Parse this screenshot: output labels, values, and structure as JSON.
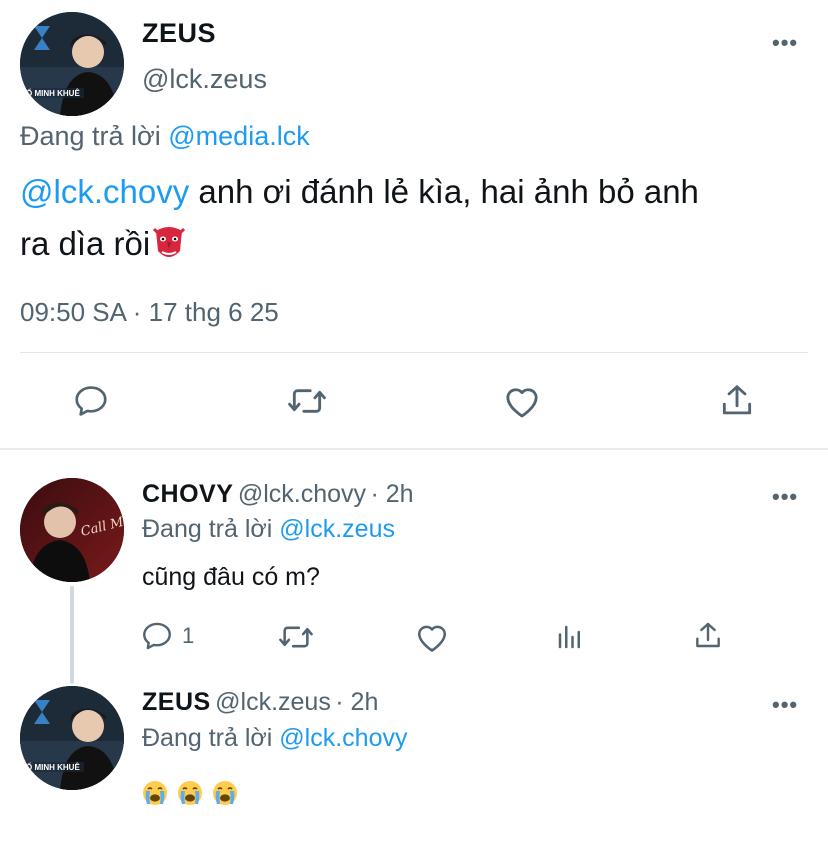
{
  "main_tweet": {
    "name": "ZEUS",
    "handle": "@lck.zeus",
    "replying_prefix": "Đang trả lời ",
    "replying_to": "@media.lck",
    "mention": "@lck.chovy",
    "text_line1": " anh ơi đánh lẻ kìa, hai ảnh bỏ anh",
    "text_line2": "ra dìa rồi",
    "emoji": "goblin-emoji",
    "timestamp": "09:50 SA · 17 thg 6 25",
    "avatar_caption": "Ố MINH KHUÊ"
  },
  "actions": {
    "reply_icon": "comment-icon",
    "retweet_icon": "retweet-icon",
    "like_icon": "heart-icon",
    "share_icon": "share-icon"
  },
  "replies": [
    {
      "name": "CHOVY",
      "handle": "@lck.chovy",
      "time": "· 2h",
      "replying_prefix": "Đang trả lời ",
      "replying_to": "@lck.zeus",
      "text": "cũng đâu có m?",
      "reply_count": "1",
      "avatar_text": "Call Me By Fire"
    },
    {
      "name": "ZEUS",
      "handle": "@lck.zeus",
      "time": "· 2h",
      "replying_prefix": "Đang trả lời ",
      "replying_to": "@lck.chovy",
      "emojis": [
        "crying-emoji",
        "crying-emoji",
        "crying-emoji"
      ],
      "avatar_caption": "Ố MINH KHUÊ"
    }
  ],
  "more_label": "•••",
  "colors": {
    "link": "#1d9bf0",
    "secondary": "#536471",
    "text": "#0f1419",
    "divider": "#e1e6ea"
  }
}
